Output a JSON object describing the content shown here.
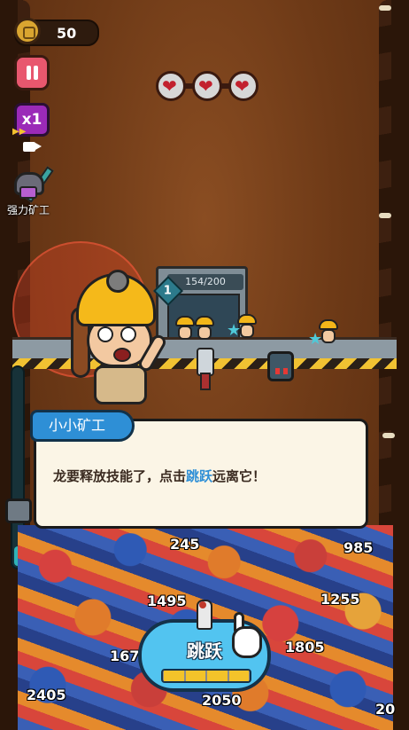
{
  "hud": {
    "coins": "50",
    "speed_label": "x1",
    "strong_miner_label": "强力矿工",
    "hearts": [
      "❤",
      "❤",
      "❤"
    ]
  },
  "machine": {
    "level": "1",
    "capacity": "154/200"
  },
  "dialog": {
    "speaker": "小小矿工",
    "text_before": "龙要释放技能了，点击",
    "text_highlight": "跳跃",
    "text_after": "远离它！"
  },
  "ore_values": [
    "245",
    "985",
    "1495",
    "1255",
    "167",
    "1805",
    "2405",
    "2050",
    "20"
  ],
  "jump": {
    "label": "跳跃",
    "charge_segments": 4,
    "charge_filled": 4
  },
  "meter": {
    "level": 0.1
  },
  "colors": {
    "accent": "#2e8fd6",
    "pause": "#e8576e",
    "speed": "#9b2ab8",
    "jump": "#52c4f0"
  }
}
